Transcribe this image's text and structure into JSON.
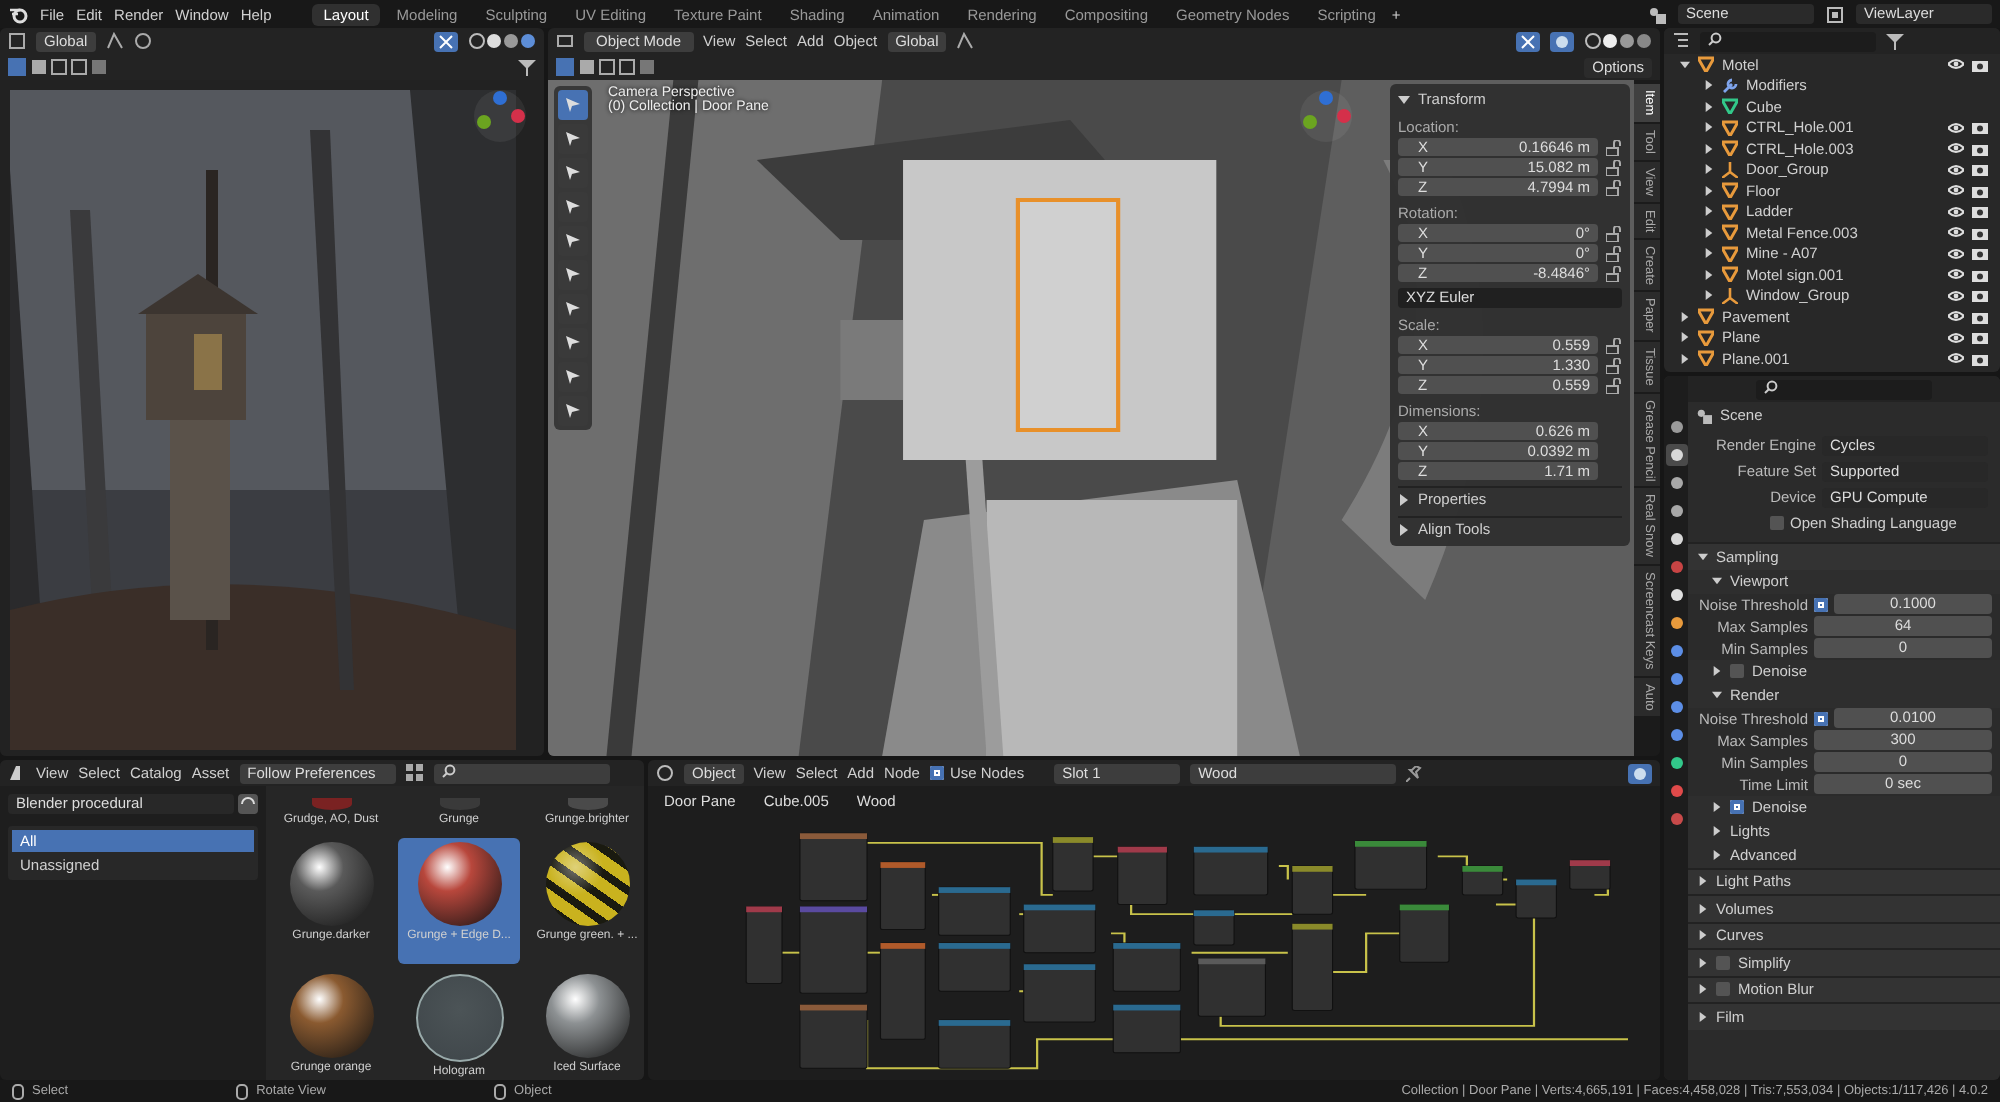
{
  "menu": [
    "File",
    "Edit",
    "Render",
    "Window",
    "Help"
  ],
  "workspaces": [
    {
      "label": "Layout",
      "selected": true
    },
    {
      "label": "Modeling",
      "selected": false
    },
    {
      "label": "Sculpting",
      "selected": false
    },
    {
      "label": "UV Editing",
      "selected": false
    },
    {
      "label": "Texture Paint",
      "selected": false
    },
    {
      "label": "Shading",
      "selected": false
    },
    {
      "label": "Animation",
      "selected": false
    },
    {
      "label": "Rendering",
      "selected": false
    },
    {
      "label": "Compositing",
      "selected": false
    },
    {
      "label": "Geometry Nodes",
      "selected": false
    },
    {
      "label": "Scripting",
      "selected": false
    }
  ],
  "add_tab": "+",
  "scene": "Scene",
  "view_layer": "ViewLayer",
  "image_editor": {
    "orientation": "Global"
  },
  "viewport": {
    "mode": "Object Mode",
    "menus": [
      "View",
      "Select",
      "Add",
      "Object"
    ],
    "orientation": "Global",
    "options": "Options",
    "overlay": [
      "Camera Perspective",
      "(0) Collection | Door Pane"
    ],
    "sidebar": {
      "title": "Transform",
      "expanded": true,
      "groups": [
        {
          "kind": "locked_vector",
          "label": "Location:",
          "rows": [
            {
              "axis": "X",
              "value": "0.16646 m"
            },
            {
              "axis": "Y",
              "value": "15.082 m"
            },
            {
              "axis": "Z",
              "value": "4.7994 m"
            }
          ]
        },
        {
          "kind": "locked_vector",
          "label": "Rotation:",
          "rows": [
            {
              "axis": "X",
              "value": "0°"
            },
            {
              "axis": "Y",
              "value": "0°"
            },
            {
              "axis": "Z",
              "value": "-8.4846°"
            }
          ]
        },
        {
          "kind": "dropdown",
          "value": "XYZ Euler"
        },
        {
          "kind": "locked_vector",
          "label": "Scale:",
          "rows": [
            {
              "axis": "X",
              "value": "0.559"
            },
            {
              "axis": "Y",
              "value": "1.330"
            },
            {
              "axis": "Z",
              "value": "0.559"
            }
          ]
        },
        {
          "kind": "vector",
          "label": "Dimensions:",
          "rows": [
            {
              "axis": "X",
              "value": "0.626 m"
            },
            {
              "axis": "Y",
              "value": "0.0392 m"
            },
            {
              "axis": "Z",
              "value": "1.71 m"
            }
          ]
        }
      ],
      "sections": [
        {
          "title": "Properties",
          "expanded": false
        },
        {
          "title": "Align Tools",
          "expanded": false
        }
      ]
    },
    "tabs": [
      {
        "label": "Item",
        "selected": true
      },
      {
        "label": "Tool",
        "selected": false
      },
      {
        "label": "View",
        "selected": false
      },
      {
        "label": "Edit",
        "selected": false
      },
      {
        "label": "Create",
        "selected": false
      },
      {
        "label": "Paper",
        "selected": false
      },
      {
        "label": "Tissue",
        "selected": false
      },
      {
        "label": "Grease Pencil",
        "selected": false
      },
      {
        "label": "Real Snow",
        "selected": false
      },
      {
        "label": "Screencast Keys",
        "selected": false
      },
      {
        "label": "Auto",
        "selected": false
      }
    ]
  },
  "outliner": {
    "items": [
      {
        "name": "Motel",
        "kind": "object",
        "expanded": true,
        "children": [
          {
            "name": "Modifiers",
            "kind": "modifiers",
            "expanded": false
          },
          {
            "name": "Cube",
            "kind": "mesh",
            "expanded": false
          },
          {
            "name": "CTRL_Hole.001",
            "kind": "object",
            "expanded": false
          },
          {
            "name": "CTRL_Hole.003",
            "kind": "object",
            "expanded": false
          },
          {
            "name": "Door_Group",
            "kind": "empty",
            "expanded": false
          },
          {
            "name": "Floor",
            "kind": "object",
            "expanded": false
          },
          {
            "name": "Ladder",
            "kind": "object",
            "expanded": false
          },
          {
            "name": "Metal Fence.003",
            "kind": "object",
            "expanded": false
          },
          {
            "name": "Mine - A07",
            "kind": "object",
            "expanded": false
          },
          {
            "name": "Motel sign.001",
            "kind": "object",
            "expanded": false
          },
          {
            "name": "Window_Group",
            "kind": "empty",
            "expanded": false
          }
        ]
      },
      {
        "name": "Pavement",
        "kind": "object",
        "expanded": false
      },
      {
        "name": "Plane",
        "kind": "object",
        "expanded": false
      },
      {
        "name": "Plane.001",
        "kind": "object",
        "expanded": false
      }
    ]
  },
  "properties": {
    "tabs": [
      {
        "kind": "tool",
        "selected": false
      },
      {
        "kind": "render",
        "selected": true
      },
      {
        "kind": "output",
        "selected": false
      },
      {
        "kind": "view_layer",
        "selected": false
      },
      {
        "kind": "scene",
        "selected": false
      },
      {
        "kind": "world",
        "selected": false
      },
      {
        "kind": "collection",
        "selected": false
      },
      {
        "kind": "object",
        "selected": false
      },
      {
        "kind": "modifiers",
        "selected": false
      },
      {
        "kind": "particles",
        "selected": false
      },
      {
        "kind": "physics",
        "selected": false
      },
      {
        "kind": "constraints",
        "selected": false
      },
      {
        "kind": "data",
        "selected": false
      },
      {
        "kind": "material",
        "selected": false
      },
      {
        "kind": "texture",
        "selected": false
      }
    ],
    "context": "Scene",
    "fields": [
      {
        "kind": "dropdown",
        "label": "Render Engine",
        "value": "Cycles"
      },
      {
        "kind": "dropdown",
        "label": "Feature Set",
        "value": "Supported"
      },
      {
        "kind": "dropdown",
        "label": "Device",
        "value": "GPU Compute"
      },
      {
        "kind": "checkbox",
        "label": "Open Shading Language",
        "checked": false
      }
    ],
    "panels": [
      {
        "title": "Sampling",
        "expanded": true,
        "subpanels": [
          {
            "title": "Viewport",
            "expanded": true,
            "rows": [
              {
                "label": "Noise Threshold",
                "value": "0.1000",
                "checked": true
              },
              {
                "label": "Max Samples",
                "value": "64"
              },
              {
                "label": "Min Samples",
                "value": "0"
              }
            ]
          },
          {
            "title": "Denoise",
            "expanded": false,
            "checked": false
          },
          {
            "title": "Render",
            "expanded": true,
            "rows": [
              {
                "label": "Noise Threshold",
                "value": "0.0100",
                "checked": true
              },
              {
                "label": "Max Samples",
                "value": "300"
              },
              {
                "label": "Min Samples",
                "value": "0"
              },
              {
                "label": "Time Limit",
                "value": "0 sec"
              }
            ]
          },
          {
            "title": "Denoise",
            "expanded": false,
            "checked": true
          },
          {
            "title": "Lights",
            "expanded": false
          },
          {
            "title": "Advanced",
            "expanded": false
          }
        ]
      },
      {
        "title": "Light Paths",
        "expanded": false
      },
      {
        "title": "Volumes",
        "expanded": false
      },
      {
        "title": "Curves",
        "expanded": false
      },
      {
        "title": "Simplify",
        "expanded": false,
        "checked": false
      },
      {
        "title": "Motion Blur",
        "expanded": false,
        "checked": false
      },
      {
        "title": "Film",
        "expanded": false
      }
    ]
  },
  "asset_browser": {
    "menus": [
      "View",
      "Select",
      "Catalog",
      "Asset"
    ],
    "import_method": "Follow Preferences",
    "library": "Blender procedural",
    "catalogs": [
      {
        "label": "All",
        "selected": true
      },
      {
        "label": "Unassigned",
        "selected": false
      }
    ],
    "assets": [
      {
        "name": "Grudge, AO, Dust",
        "kind": "cut",
        "selected": false,
        "color": "#7a2222"
      },
      {
        "name": "Grunge",
        "kind": "cut",
        "selected": false,
        "color": "#3a3a3a"
      },
      {
        "name": "Grunge.brighter",
        "kind": "cut",
        "selected": false,
        "color": "#4a4a4a"
      },
      {
        "name": "Grunge.darker",
        "kind": "full",
        "selected": false,
        "color": "#5a5a5a"
      },
      {
        "name": "Grunge + Edge D...",
        "kind": "full",
        "selected": true,
        "color": "#b8473c"
      },
      {
        "name": "Grunge green. + ...",
        "kind": "striped",
        "selected": false,
        "color": "#c9b21e"
      },
      {
        "name": "Grunge orange",
        "kind": "full",
        "selected": false,
        "color": "#8a5a30"
      },
      {
        "name": "Hologram",
        "kind": "glass",
        "selected": false,
        "color": "#3e4549"
      },
      {
        "name": "Iced Surface",
        "kind": "full",
        "selected": false,
        "color": "#8d9193"
      }
    ]
  },
  "node_editor": {
    "object_type": "Object",
    "menus": [
      "View",
      "Select",
      "Add",
      "Node"
    ],
    "use_nodes": {
      "label": "Use Nodes",
      "checked": true
    },
    "slot": "Slot 1",
    "material": "Wood",
    "breadcrumbs": [
      "Door Pane",
      "Cube.005",
      "Wood"
    ]
  },
  "status_bar": {
    "hints": [
      "Select",
      "Rotate View",
      "Object"
    ],
    "stats": "Collection | Door Pane | Verts:4,665,191 | Faces:4,458,028 | Tris:7,553,034 | Objects:1/117,426 | 4.0.2"
  }
}
